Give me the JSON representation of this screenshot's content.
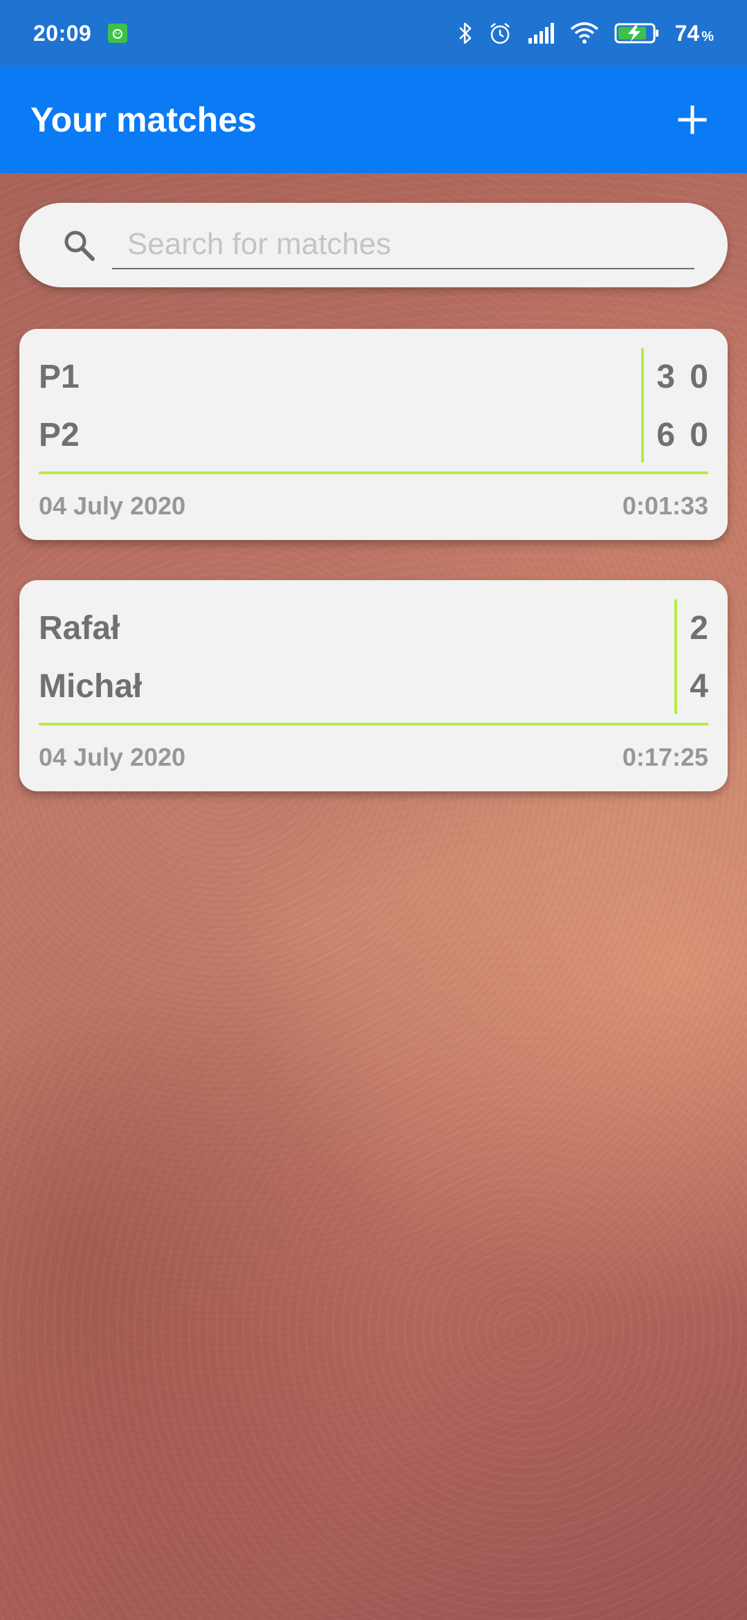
{
  "status_bar": {
    "time": "20:09",
    "battery_percent": "74",
    "battery_unit": "%",
    "icons": [
      "notification-app-icon",
      "bluetooth-icon",
      "alarm-icon",
      "signal-icon",
      "wifi-icon",
      "battery-charging-icon"
    ]
  },
  "app_bar": {
    "title": "Your matches",
    "add_icon": "plus-icon"
  },
  "search": {
    "placeholder": "Search for matches",
    "value": "",
    "icon": "search-icon"
  },
  "matches": [
    {
      "player1": "P1",
      "player2": "P2",
      "score1": "3 0",
      "score2": "6 0",
      "date": "04 July 2020",
      "duration": "0:01:33"
    },
    {
      "player1": "Rafał",
      "player2": "Michał",
      "score1": "2",
      "score2": "4",
      "date": "04 July 2020",
      "duration": "0:17:25"
    }
  ],
  "colors": {
    "status_bar": "#1f73d1",
    "app_bar": "#0a7af5",
    "card_bg": "#f2f2f2",
    "accent_line": "#b7ec3e",
    "text_primary": "#707070",
    "text_secondary": "#979797"
  }
}
